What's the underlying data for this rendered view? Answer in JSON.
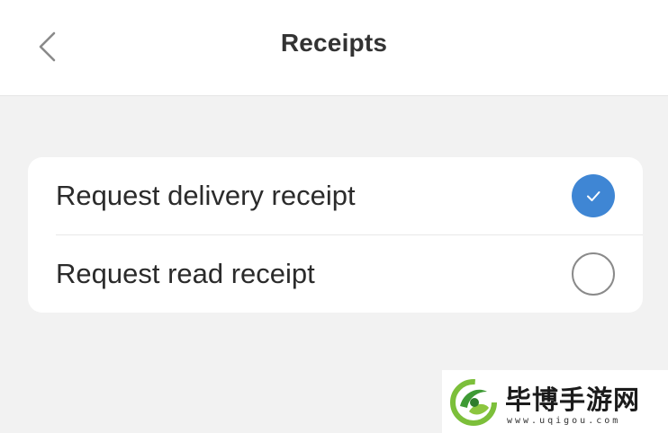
{
  "header": {
    "title": "Receipts",
    "back_icon": "chevron-left-icon"
  },
  "receipts": {
    "items": [
      {
        "label": "Request delivery receipt",
        "checked": true
      },
      {
        "label": "Request read receipt",
        "checked": false
      }
    ]
  },
  "colors": {
    "accent": "#3f86d4",
    "background": "#f2f2f2",
    "card": "#ffffff"
  },
  "watermark": {
    "title": "毕博手游网",
    "url": "www.uqigou.com"
  }
}
